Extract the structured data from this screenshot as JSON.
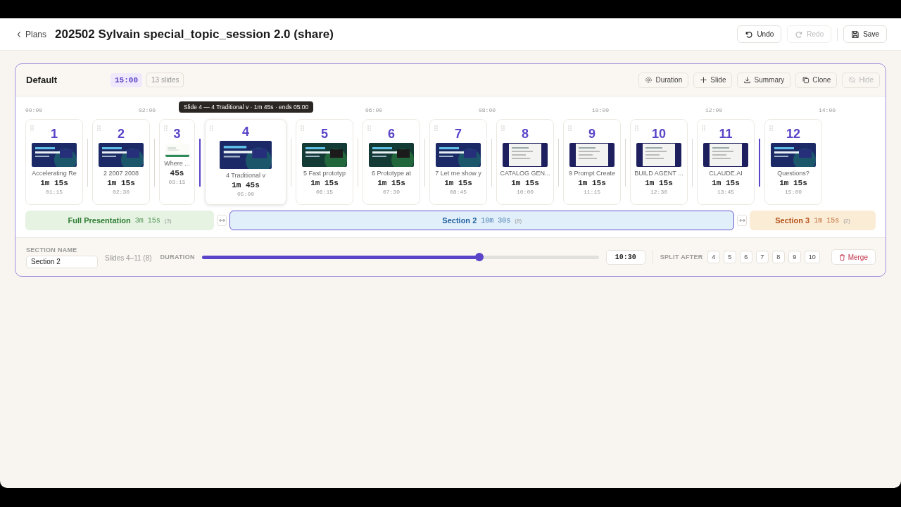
{
  "header": {
    "back": "Plans",
    "title": "202502 Sylvain special_topic_session 2.0 (share)",
    "actions": [
      {
        "label": "Undo",
        "disabled": false
      },
      {
        "label": "Redo",
        "disabled": true
      },
      {
        "label": "Save",
        "disabled": false
      }
    ]
  },
  "plan": {
    "name": "Default",
    "total": "15:00",
    "slide_count": "13 slides",
    "tools": [
      {
        "label": "Duration",
        "disabled": false
      },
      {
        "label": "Slide",
        "disabled": false
      },
      {
        "label": "Summary",
        "disabled": false
      },
      {
        "label": "Clone",
        "disabled": false
      },
      {
        "label": "Hide",
        "disabled": true
      }
    ],
    "ticks": [
      "00:00",
      "02:00",
      "06:00",
      "08:00",
      "10:00",
      "12:00",
      "14:00"
    ],
    "tooltip": "Slide 4 — 4 Traditional v · 1m 45s · ends 05:00",
    "slides": [
      {
        "number": "1",
        "title": "Accelerating Re",
        "duration": "1m 15s",
        "ends": "01:15",
        "hovered": false,
        "boundary_before": false
      },
      {
        "number": "2",
        "title": "2 2007 2008",
        "duration": "1m 15s",
        "ends": "02:30",
        "hovered": false,
        "boundary_before": false
      },
      {
        "number": "3",
        "title": "Where ...",
        "duration": "45s",
        "ends": "03:15",
        "hovered": false,
        "boundary_before": false
      },
      {
        "number": "4",
        "title": "4 Traditional v",
        "duration": "1m 45s",
        "ends": "05:00",
        "hovered": true,
        "boundary_before": true
      },
      {
        "number": "5",
        "title": "5 Fast prototyp",
        "duration": "1m 15s",
        "ends": "06:15",
        "hovered": false,
        "boundary_before": false
      },
      {
        "number": "6",
        "title": "6 Prototype at",
        "duration": "1m 15s",
        "ends": "07:30",
        "hovered": false,
        "boundary_before": false
      },
      {
        "number": "7",
        "title": "7 Let me show y",
        "duration": "1m 15s",
        "ends": "08:45",
        "hovered": false,
        "boundary_before": false
      },
      {
        "number": "8",
        "title": "CATALOG GEN...",
        "duration": "1m 15s",
        "ends": "10:00",
        "hovered": false,
        "boundary_before": false
      },
      {
        "number": "9",
        "title": "9 Prompt Create",
        "duration": "1m 15s",
        "ends": "11:15",
        "hovered": false,
        "boundary_before": false
      },
      {
        "number": "10",
        "title": "BUILD AGENT ...",
        "duration": "1m 15s",
        "ends": "12:30",
        "hovered": false,
        "boundary_before": false
      },
      {
        "number": "11",
        "title": "CLAUDE.AI",
        "duration": "1m 15s",
        "ends": "13:45",
        "hovered": false,
        "boundary_before": false
      },
      {
        "number": "12",
        "title": "Questions?",
        "duration": "1m 15s",
        "ends": "15:00",
        "hovered": false,
        "boundary_before": true
      }
    ],
    "sections": [
      {
        "name": "Full Presentation",
        "duration": "3m 15s",
        "count": "(3)",
        "color": "#2e7d32",
        "selected": false
      },
      {
        "name": "Section 2",
        "duration": "10m 30s",
        "count": "(8)",
        "color": "#1f5f9e",
        "selected": true
      },
      {
        "name": "Section 3",
        "duration": "1m 15s",
        "count": "(2)",
        "color": "#b4531a",
        "selected": false
      }
    ],
    "editor": {
      "name_label": "SECTION NAME",
      "name_value": "Section 2",
      "range": "Slides 4–11 (8)",
      "duration_label": "DURATION",
      "level": 0.7,
      "duration_value": "10:30",
      "split_label": "SPLIT AFTER",
      "split_options": [
        "4",
        "5",
        "6",
        "7",
        "8",
        "9",
        "10"
      ],
      "merge": "Merge"
    }
  }
}
